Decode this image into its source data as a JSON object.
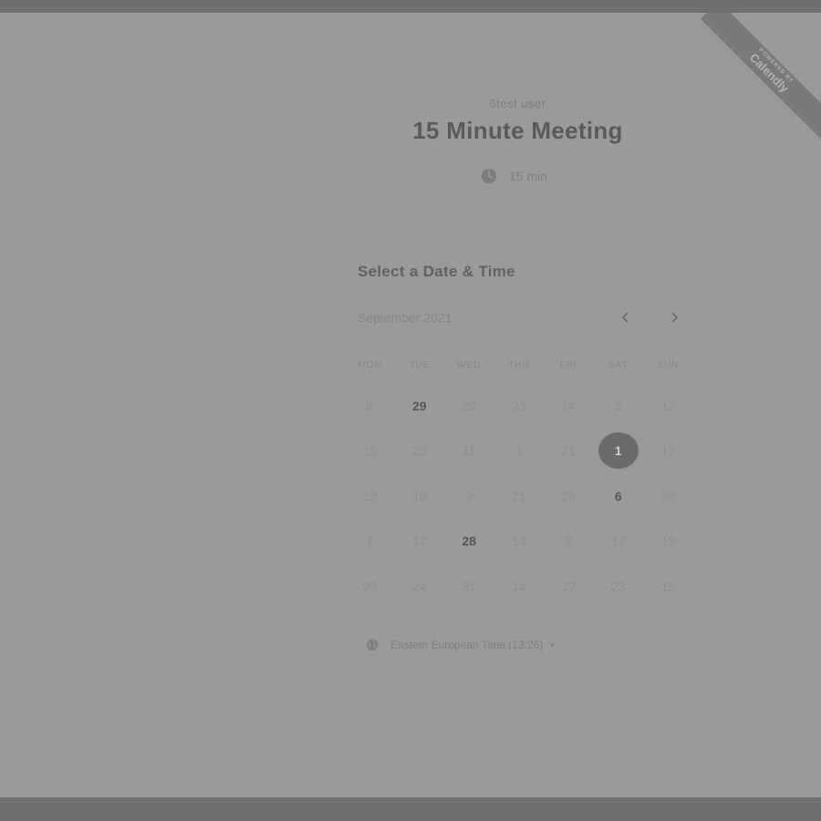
{
  "ribbon": {
    "powered_by": "POWERED BY",
    "brand": "Calendly"
  },
  "event": {
    "host": "6test user",
    "title": "15 Minute Meeting",
    "duration": "15 min"
  },
  "scheduler": {
    "section_title": "Select a Date & Time",
    "month_label": "September 2021",
    "days_of_week": [
      "MON",
      "TUE",
      "WED",
      "THU",
      "FRI",
      "SAT",
      "SUN"
    ],
    "weeks": [
      [
        {
          "d": "8"
        },
        {
          "d": "29",
          "available": true
        },
        {
          "d": "29"
        },
        {
          "d": "23"
        },
        {
          "d": "14"
        },
        {
          "d": "5"
        },
        {
          "d": "12"
        }
      ],
      [
        {
          "d": "15"
        },
        {
          "d": "20"
        },
        {
          "d": "11"
        },
        {
          "d": "1"
        },
        {
          "d": "21"
        },
        {
          "d": "1",
          "selected": true
        },
        {
          "d": "17"
        }
      ],
      [
        {
          "d": "12"
        },
        {
          "d": "18"
        },
        {
          "d": "9"
        },
        {
          "d": "21"
        },
        {
          "d": "28"
        },
        {
          "d": "6",
          "available": true
        },
        {
          "d": "30"
        }
      ],
      [
        {
          "d": "7"
        },
        {
          "d": "17"
        },
        {
          "d": "28",
          "available": true
        },
        {
          "d": "14"
        },
        {
          "d": "8"
        },
        {
          "d": "17"
        },
        {
          "d": "19"
        }
      ],
      [
        {
          "d": "20"
        },
        {
          "d": "24"
        },
        {
          "d": "31"
        },
        {
          "d": "14"
        },
        {
          "d": "27"
        },
        {
          "d": "23"
        },
        {
          "d": "15"
        }
      ]
    ],
    "timezone": "Eastern European Time (13:26)"
  },
  "colors": {
    "overlay_bg": "#9a9a9a",
    "selected_day_bg": "#6b6b6b"
  }
}
